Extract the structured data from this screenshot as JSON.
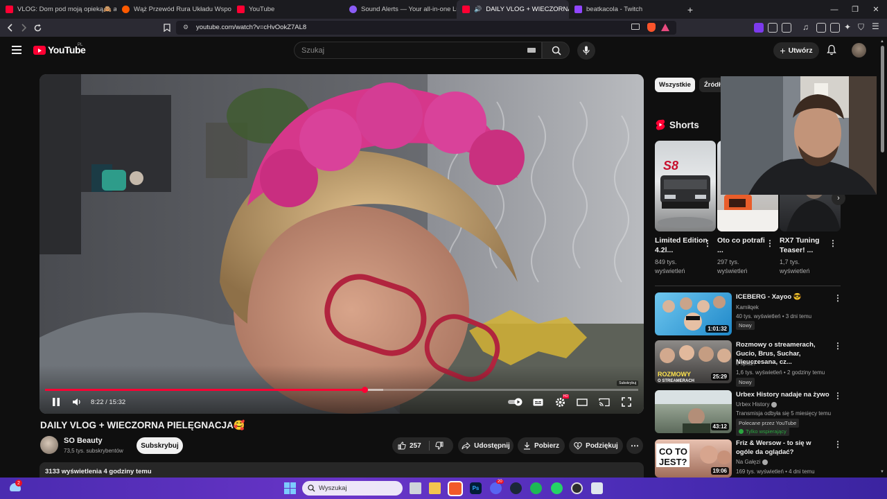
{
  "browser": {
    "tabs": [
      {
        "title": "VLOG: Dom pod moją opieką🙈 a ro",
        "favicon_color": "#ff0033",
        "active": false
      },
      {
        "title": "Wąż Przewód Rura Układu Wspomag",
        "favicon_color": "#ff5a00",
        "active": false
      },
      {
        "title": "YouTube",
        "favicon_color": "#ff0033",
        "active": false
      },
      {
        "title": "Sound Alerts — Your all-in-one Lives",
        "favicon_color": "#8b5cf6",
        "active": false
      },
      {
        "title": "DAILY VLOG + WIECZORNA P",
        "favicon_color": "#ff0033",
        "active": true
      },
      {
        "title": "beatkacola - Twitch",
        "favicon_color": "#9146ff",
        "active": false
      }
    ],
    "new_tab_glyph": "+",
    "close_glyph": "✕",
    "window_controls": {
      "minimize": "—",
      "maximize": "❐",
      "close": "✕"
    },
    "url": "youtube.com/watch?v=cHvOokZ7AL8"
  },
  "youtube": {
    "logo_text": "YouTube",
    "country_code": "PL",
    "search_placeholder": "Szukaj",
    "create_label": "Utwórz"
  },
  "player": {
    "current_time": "8:22",
    "duration": "15:32",
    "time_display": "8:22 / 15:32",
    "progress_fraction": 0.539,
    "buffered_fraction": 0.57,
    "subscribe_watermark": "Subskrybuj",
    "hd_badge": "HD"
  },
  "video": {
    "title": "DAILY VLOG + WIECZORNA PIELĘGNACJA🥰",
    "channel_name": "SO Beauty",
    "channel_subs": "73,5 tys. subskrybentów",
    "subscribe_label": "Subskrybuj",
    "likes": "257",
    "share_label": "Udostępnij",
    "download_label": "Pobierz",
    "thanks_label": "Podziękuj",
    "views_line": "3133 wyświetlenia  4 godziny temu"
  },
  "sidebar": {
    "chips": [
      "Wszystkie",
      "Źródło"
    ],
    "shorts_heading": "Shorts",
    "shorts": [
      {
        "title": "Limited Edition 4.2l...",
        "views": "849 tys. wyświetleń"
      },
      {
        "title": "Oto co potrafi ...",
        "views": "297 tys. wyświetleń"
      },
      {
        "title": "RX7 Tuning Teaser! ...",
        "views": "1,7 tys. wyświetleń"
      }
    ],
    "short_thumb_text": "S8",
    "recommendations": [
      {
        "title": "ICEBERG - Xayoo 😎",
        "channel": "Kamiłqek",
        "meta": "40 tys. wyświetleń • 3 dni temu",
        "duration": "1:01:32",
        "badge": "Nowy"
      },
      {
        "title": "Rozmowy o streamerach, Gucio, Brus, Suchar, Nieuczesana, cz...",
        "channel": "e śpisz?",
        "meta": "1,6 tys. wyświetleń • 2 godziny temu",
        "duration": "25:29",
        "badge": "Nowy",
        "thumb_text": "ROZMOWY O STREAMERACH"
      },
      {
        "title": "Urbex History nadaje na żywo",
        "channel": "Urbex History",
        "meta": "Transmisja odbyła się 5 miesięcy temu",
        "duration": "43:12",
        "badge": "Polecane przez YouTube",
        "badge2": "Tylko wspierający"
      },
      {
        "title": "Friz & Wersow - to się w ogóle da oglądać?",
        "channel": "Na Gałęzi",
        "meta": "169 tys. wyświetleń • 4 dni temu",
        "duration": "19:06",
        "thumb_text": "CO TO JEST?"
      }
    ]
  },
  "taskbar": {
    "search_placeholder": "Wyszukaj",
    "notification_count": "2",
    "discord_badge": "20"
  },
  "colors": {
    "accent": "#ff0033",
    "background": "#0f0f0f",
    "surface": "#272727",
    "taskbar": "#5a33c0"
  }
}
